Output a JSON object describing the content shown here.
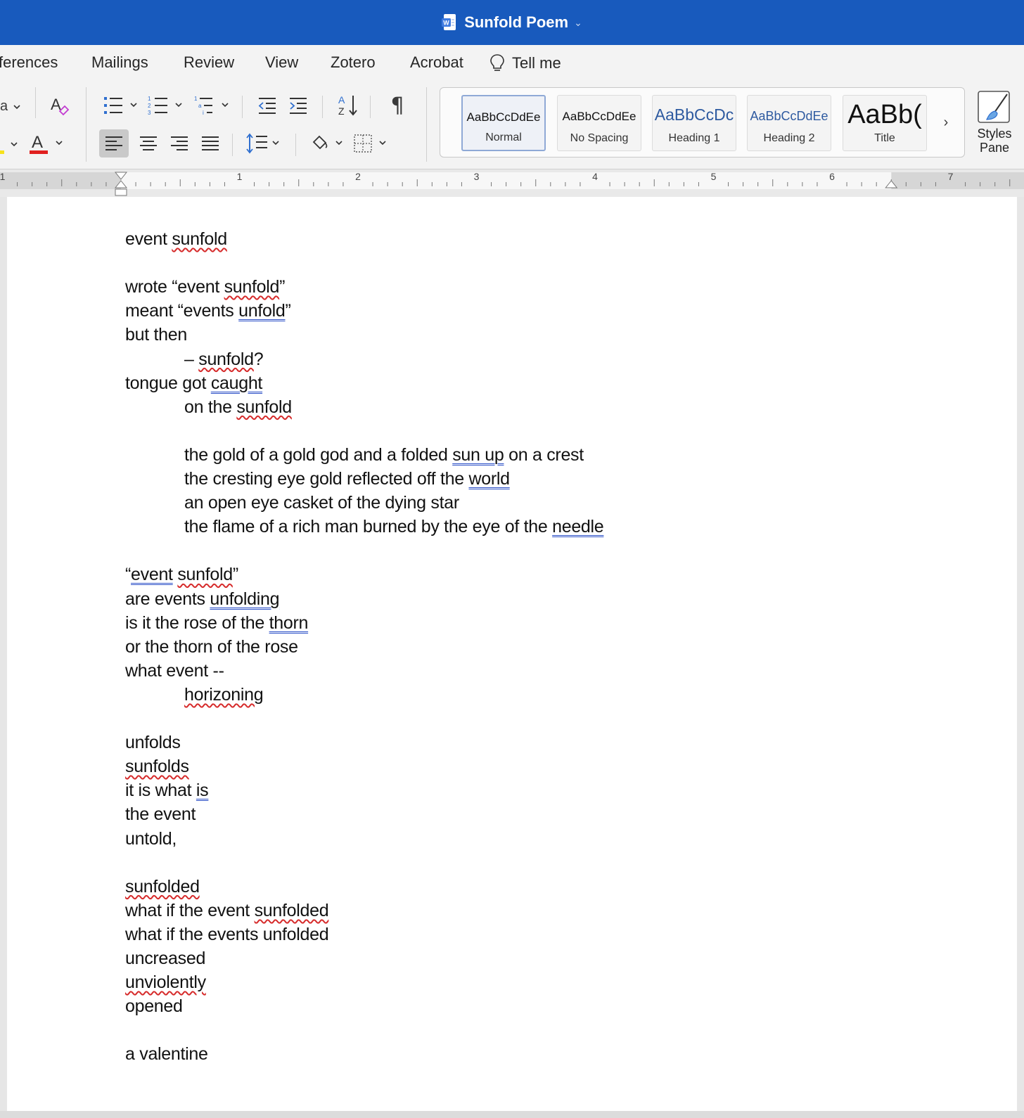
{
  "window": {
    "title": "Sunfold Poem"
  },
  "tabs": [
    "ferences",
    "Mailings",
    "Review",
    "View",
    "Zotero",
    "Acrobat",
    "Tell me"
  ],
  "ribbon": {
    "font_partial": "a",
    "font_color": "#e0201f",
    "highlight_color": "#f7e21b",
    "styles": [
      {
        "sample": "AaBbCcDdEe",
        "name": "Normal",
        "selected": true
      },
      {
        "sample": "AaBbCcDdEe",
        "name": "No Spacing"
      },
      {
        "sample": "AaBbCcDc",
        "name": "Heading 1"
      },
      {
        "sample": "AaBbCcDdEe",
        "name": "Heading 2"
      },
      {
        "sample": "AaBb(",
        "name": "Title"
      }
    ],
    "styles_pane_label_1": "Styles",
    "styles_pane_label_2": "Pane"
  },
  "ruler": {
    "numbers": [
      "1",
      "1",
      "2",
      "3",
      "4",
      "5",
      "6",
      "7"
    ]
  },
  "document": {
    "lines": [
      [
        {
          "t": "event "
        },
        {
          "t": "sunfold",
          "s": "spell"
        }
      ],
      [],
      [
        {
          "t": "wrote “event "
        },
        {
          "t": "sunfold",
          "s": "spell"
        },
        {
          "t": "”"
        }
      ],
      [
        {
          "t": "meant “events "
        },
        {
          "t": "unfold",
          "s": "gram"
        },
        {
          "t": "”"
        }
      ],
      [
        {
          "t": "but then"
        }
      ],
      [
        {
          "t": "– ",
          "ind": true
        },
        {
          "t": "sunfold",
          "s": "spell"
        },
        {
          "t": "?"
        }
      ],
      [
        {
          "t": "tongue got "
        },
        {
          "t": "caught",
          "s": "gram"
        }
      ],
      [
        {
          "t": "on the ",
          "ind": true
        },
        {
          "t": "sunfold",
          "s": "spell"
        }
      ],
      [],
      [
        {
          "t": "the gold of a gold god and a folded ",
          "ind": true
        },
        {
          "t": "sun up",
          "s": "gram"
        },
        {
          "t": " on a crest"
        }
      ],
      [
        {
          "t": "the cresting eye gold reflected off the ",
          "ind": true
        },
        {
          "t": "world",
          "s": "gram"
        }
      ],
      [
        {
          "t": "an open eye casket of the dying star",
          "ind": true
        }
      ],
      [
        {
          "t": "the flame of a rich man burned by the eye of the ",
          "ind": true
        },
        {
          "t": "needle",
          "s": "gram"
        }
      ],
      [],
      [
        {
          "t": "“"
        },
        {
          "t": "event",
          "s": "gram"
        },
        {
          "t": " "
        },
        {
          "t": "sunfold",
          "s": "spell"
        },
        {
          "t": "”"
        }
      ],
      [
        {
          "t": "are events "
        },
        {
          "t": "unfolding",
          "s": "gram"
        }
      ],
      [
        {
          "t": "is it the rose of the "
        },
        {
          "t": "thorn",
          "s": "gram"
        }
      ],
      [
        {
          "t": "or the thorn of the rose"
        }
      ],
      [
        {
          "t": "what event --"
        }
      ],
      [
        {
          "t": "",
          "ind": true
        },
        {
          "t": "horizoning",
          "s": "spell"
        }
      ],
      [],
      [
        {
          "t": "unfolds"
        }
      ],
      [
        {
          "t": "sunfolds",
          "s": "spell"
        }
      ],
      [
        {
          "t": "it is what "
        },
        {
          "t": "is",
          "s": "gram"
        }
      ],
      [
        {
          "t": "the event"
        }
      ],
      [
        {
          "t": "untold,"
        }
      ],
      [],
      [
        {
          "t": "sunfolded",
          "s": "spell"
        }
      ],
      [
        {
          "t": "what if the event "
        },
        {
          "t": "sunfolded",
          "s": "spell"
        }
      ],
      [
        {
          "t": "what if the events unfolded"
        }
      ],
      [
        {
          "t": "uncreased"
        }
      ],
      [
        {
          "t": "unviolently",
          "s": "spell"
        }
      ],
      [
        {
          "t": "opened"
        }
      ],
      [],
      [
        {
          "t": "a valentine"
        }
      ]
    ]
  }
}
